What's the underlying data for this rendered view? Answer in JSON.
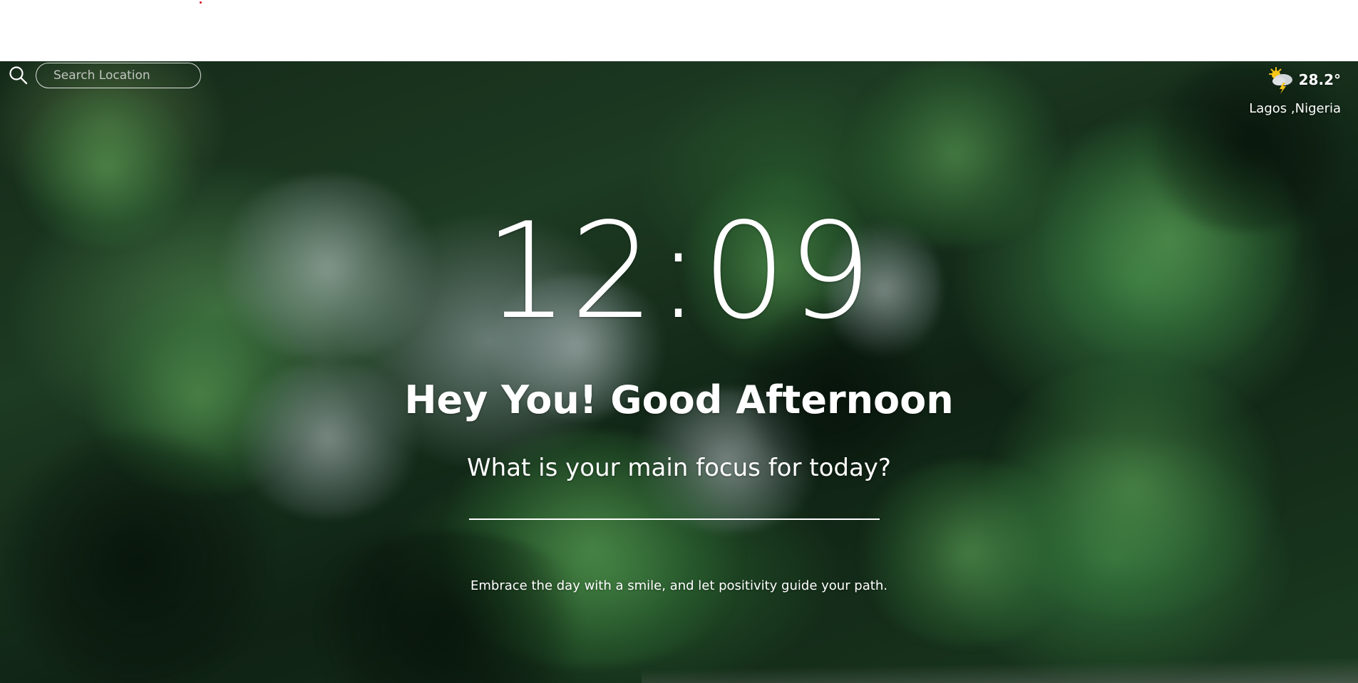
{
  "search": {
    "placeholder": "Search Location",
    "icon": "search-icon"
  },
  "weather": {
    "icon": "partly-cloudy-thunder-icon",
    "temperature": "28.2°",
    "location": "Lagos ,Nigeria"
  },
  "clock": {
    "time": "12:09"
  },
  "greeting": {
    "text": "Hey You! Good Afternoon"
  },
  "focus": {
    "question": "What is your main focus for today?",
    "value": ""
  },
  "quote": {
    "text": "Embrace the day with a smile, and let positivity guide your path."
  },
  "background": {
    "description_colors": {
      "forest_dark": "#142a19",
      "forest_green": "#3f8246"
    }
  },
  "colors": {
    "text": "#ffffff",
    "top_bar": "#ffffff",
    "accent_dot": "#d0021b"
  }
}
